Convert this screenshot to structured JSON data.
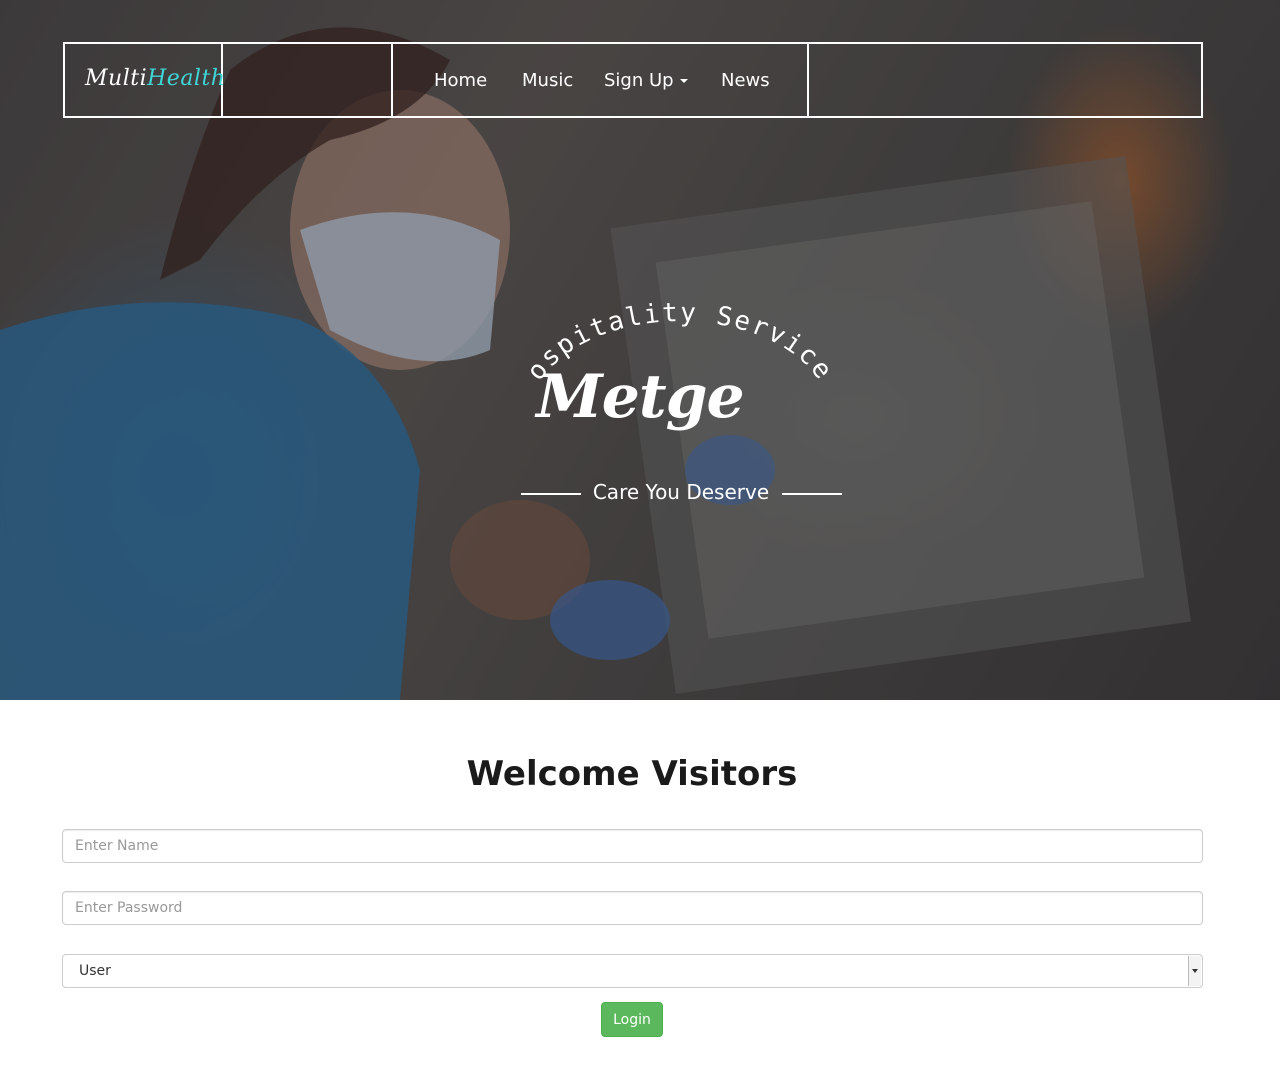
{
  "navbar": {
    "logo": {
      "part1": "Multi",
      "part2": "Health"
    },
    "items": [
      {
        "label": "Home"
      },
      {
        "label": "Music"
      },
      {
        "label": "Sign Up"
      },
      {
        "label": "News"
      }
    ]
  },
  "hero": {
    "arc_text": "Hospitality Services",
    "brand": "Metge",
    "tagline": "Care You Deserve"
  },
  "welcome": {
    "title": "Welcome Visitors"
  },
  "form": {
    "name_placeholder": "Enter Name",
    "password_placeholder": "Enter Password",
    "role_selected": "User",
    "login_label": "Login"
  },
  "colors": {
    "logo_accent": "#3ed6d6",
    "login_button": "#5cb85c"
  }
}
